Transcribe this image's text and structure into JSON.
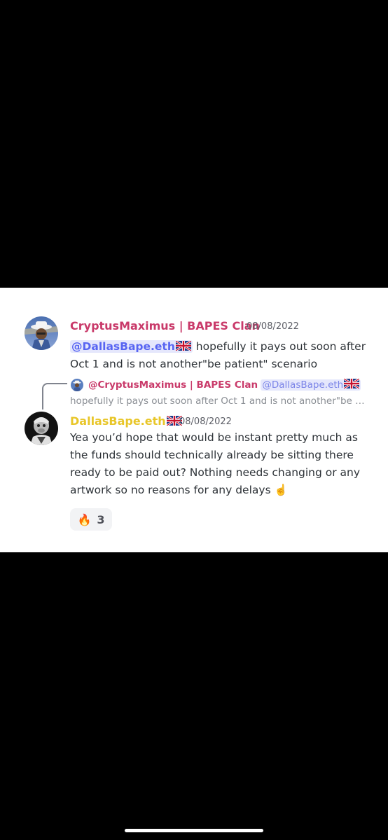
{
  "messages": [
    {
      "username": "CryptusMaximus | BAPES Clan",
      "username_color": "#c93a6a",
      "timestamp": "08/08/2022",
      "mention": "@DallasBape.eth",
      "mention_flag": "uk-flag-icon",
      "line1_rest": " hopefully it pays out soon after",
      "line2": "Oct 1 and is not another\"be patient\" scenario"
    },
    {
      "reply": {
        "username": "@CryptusMaximus | BAPES Clan",
        "mention": "@DallasBape.eth",
        "preview": "hopefully it pays out soon after Oct 1 and is not another\"be …"
      },
      "username": "DallasBape.eth",
      "username_color": "#e8c629",
      "timestamp": "08/08/2022",
      "lines": [
        "Yea you’d hope that would be instant pretty much as",
        "the funds should technically already be sitting there",
        "ready to be paid out? Nothing needs changing or any",
        "artwork so no reasons for any delays"
      ],
      "trailing_emoji": "☝️",
      "reaction": {
        "emoji": "🔥",
        "count": "3"
      }
    }
  ]
}
